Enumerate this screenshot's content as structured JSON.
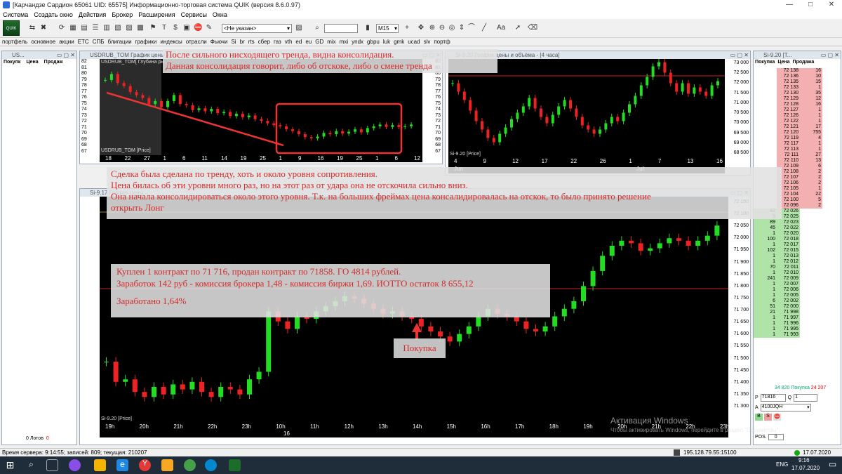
{
  "titlebar": {
    "title": "[Карчандзе Сардион 65061 UID: 65575] Информационно-торговая система QUIK (версия 8.6.0.97)",
    "minimize": "—",
    "maximize": "□",
    "close": "✕"
  },
  "menu": [
    "Система",
    "Создать окно",
    "Действия",
    "Брокер",
    "Расширения",
    "Сервисы",
    "Окна"
  ],
  "toolbar": {
    "account_select": "<Не указан>",
    "interval_select": "M15"
  },
  "tabs": [
    "портфель",
    "основное",
    "акции",
    "ETC",
    "СПБ",
    "блигации",
    "графики",
    "индексы",
    "отрасли",
    "Фьючи",
    "Si",
    "br",
    "rts",
    "сбер",
    "газ",
    "vth",
    "ed",
    "eu",
    "GD",
    "mix",
    "mxi",
    "yndx",
    "gbpu",
    "luk",
    "gmk",
    "ucad",
    "slv",
    "портф"
  ],
  "left_panel": {
    "title": "US...",
    "cols": [
      "Покупк",
      "Цена",
      "Продаж"
    ],
    "lots": "0 Лотов",
    "lots_count": "0"
  },
  "chart1": {
    "title": "USDRUB_TOM График цены и о...",
    "inner_label": "USDRUB_TOM[ Глубина ры...",
    "bottom_label": "USDRUB_TOM [Price]",
    "y_ticks": [
      "82",
      "81",
      "80",
      "79",
      "78",
      "77",
      "76",
      "75",
      "74",
      "73",
      "72",
      "71",
      "70",
      "69",
      "68",
      "67"
    ],
    "price_marker": "71.5306",
    "time_ticks": [
      "18",
      "22",
      "27",
      "1",
      "6",
      "11",
      "14",
      "19",
      "25",
      "1",
      "9",
      "16",
      "19",
      "25",
      "1",
      "6",
      "12"
    ]
  },
  "chart2": {
    "title": "Si-9.20 График цены и объёма - [4 часа]",
    "bottom_label": "Si-9.20 [Price]",
    "y_ticks": [
      "73 000",
      "72 500",
      "72 000",
      "71 500",
      "71 000",
      "70 500",
      "70 000",
      "69 500",
      "69 000",
      "68 500"
    ],
    "price_marker": "72 096",
    "time_ticks": [
      "4",
      "9",
      "12",
      "17",
      "22",
      "26",
      "1",
      "7",
      "13",
      "16"
    ],
    "month_labels": [
      "Jun",
      "Jul"
    ]
  },
  "chart3": {
    "title": "Si-9.17 График цены ...",
    "bottom_label": "Si-9.20 [Price]",
    "y_ticks": [
      "72 150",
      "72 100",
      "72 050",
      "72 000",
      "71 950",
      "71 900",
      "71 850",
      "71 800",
      "71 750",
      "71 700",
      "71 650",
      "71 600",
      "71 550",
      "71 500",
      "71 450",
      "71 400",
      "71 350",
      "71 300"
    ],
    "price_marker": "72 096",
    "time_ticks": [
      "19h",
      "20h",
      "21h",
      "22h",
      "23h",
      "10h",
      "11h",
      "12h",
      "13h",
      "14h",
      "15h",
      "16h",
      "17h",
      "18h",
      "19h",
      "20h",
      "21h",
      "22h",
      "23h"
    ],
    "day_label": "16"
  },
  "orderbook": {
    "title": "Si-9.20 [Т...",
    "cols": [
      "Покупка",
      "Цена",
      "Продажа"
    ],
    "asks": [
      {
        "price": "72 138",
        "vol": "16"
      },
      {
        "price": "72 136",
        "vol": "10"
      },
      {
        "price": "72 135",
        "vol": "15"
      },
      {
        "price": "72 133",
        "vol": "1"
      },
      {
        "price": "72 130",
        "vol": "35"
      },
      {
        "price": "72 129",
        "vol": "12"
      },
      {
        "price": "72 128",
        "vol": "16"
      },
      {
        "price": "72 127",
        "vol": "1"
      },
      {
        "price": "72 126",
        "vol": "1"
      },
      {
        "price": "72 122",
        "vol": "1"
      },
      {
        "price": "72 121",
        "vol": "17"
      },
      {
        "price": "72 120",
        "vol": "755"
      },
      {
        "price": "72 119",
        "vol": "4"
      },
      {
        "price": "72 117",
        "vol": "1"
      },
      {
        "price": "72 113",
        "vol": "1"
      },
      {
        "price": "72 111",
        "vol": "27"
      },
      {
        "price": "72 110",
        "vol": "13"
      },
      {
        "price": "72 109",
        "vol": "6"
      },
      {
        "price": "72 108",
        "vol": "2"
      },
      {
        "price": "72 107",
        "vol": "2"
      },
      {
        "price": "72 106",
        "vol": "2"
      },
      {
        "price": "72 105",
        "vol": "1"
      },
      {
        "price": "72 104",
        "vol": "22"
      },
      {
        "price": "72 100",
        "vol": "5"
      },
      {
        "price": "72 096",
        "vol": "2"
      }
    ],
    "bids": [
      {
        "price": "72 026",
        "vol": "82"
      },
      {
        "price": "72 025",
        "vol": "9"
      },
      {
        "price": "72 023",
        "vol": "89"
      },
      {
        "price": "72 022",
        "vol": "45"
      },
      {
        "price": "72 020",
        "vol": "1"
      },
      {
        "price": "72 018",
        "vol": "100"
      },
      {
        "price": "72 017",
        "vol": "1"
      },
      {
        "price": "72 015",
        "vol": "102"
      },
      {
        "price": "72 013",
        "vol": "1"
      },
      {
        "price": "72 012",
        "vol": "1"
      },
      {
        "price": "72 011",
        "vol": "70"
      },
      {
        "price": "72 010",
        "vol": "1"
      },
      {
        "price": "72 009",
        "vol": "241"
      },
      {
        "price": "72 007",
        "vol": "1"
      },
      {
        "price": "72 006",
        "vol": "1"
      },
      {
        "price": "72 005",
        "vol": "1"
      },
      {
        "price": "72 002",
        "vol": "6"
      },
      {
        "price": "72 000",
        "vol": "51"
      },
      {
        "price": "71 998",
        "vol": "21"
      },
      {
        "price": "71 997",
        "vol": "1"
      },
      {
        "price": "71 996",
        "vol": "1"
      },
      {
        "price": "71 995",
        "vol": "1"
      },
      {
        "price": "71 993",
        "vol": "1"
      }
    ],
    "total_buy": "34 820",
    "total_buy_label": "Покупка",
    "total_sell": "24 207",
    "price_label": "P",
    "price_value": "71816",
    "qty_label": "Q",
    "qty_value": "1",
    "account_label": "A",
    "account_value": "4100JQH",
    "btn_buy": "B",
    "btn_sell": "S",
    "pos_label": "POS.",
    "pos_value": "0"
  },
  "notes": {
    "top": [
      "После сильного нисходящего тренда, видна консолидация.",
      "Данная консолидация говорит, либо об отскоке, либо о смене тренда"
    ],
    "middle": [
      "Сделка была сделана по тренду, хоть и около уровня сопротивления.",
      "Цена билась об эти уровни много раз, но на этот раз от удара она не отскочила сильно вниз.",
      "Она начала консолидироваться около этого уровня.  Т.к. на больших фреймах цена консалидировалась на отскок, то было принято решение",
      "открыть Лонг"
    ],
    "trade": [
      "Куплен 1 контракт по 71 716, продан контракт по 71858.  ГО 4814 рублей.",
      "Заработок 142 руб - комиссия брокера 1,48 - комиссия биржи 1,69. ИОТТО остаток 8 655,12",
      "Заработано 1,64%"
    ],
    "buy_label": "Покупка"
  },
  "watermark": [
    "Активация Windows",
    "Чтобы активировать Windows, перейдите в раздел \"Параметры\"."
  ],
  "statusbar": {
    "server_time": "Время сервера: 9:14:55; записей: 809; текущая: 210207",
    "ip": "195.128.79.55:15100",
    "date": "17.07.2020"
  },
  "taskbar": {
    "lang": "ENG",
    "time": "9:16",
    "date": "17.07.2020"
  },
  "colors": {
    "bull": "#22dd22",
    "bear": "#ee2222",
    "note_text": "#d42c2c",
    "ask_bg": "#f4b0b0",
    "bid_bg": "#b0e3a8"
  }
}
